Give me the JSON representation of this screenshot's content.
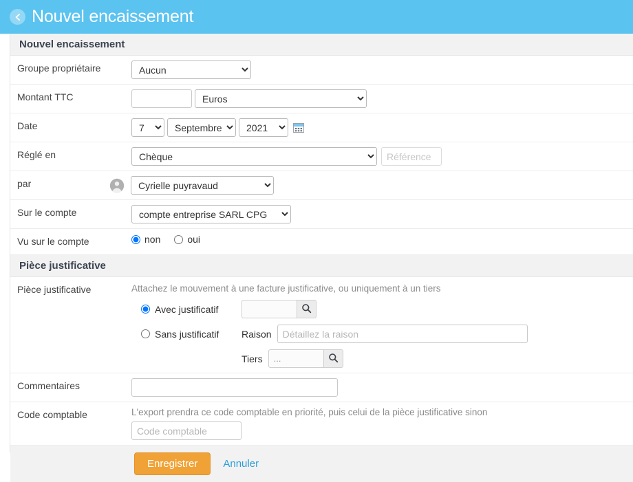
{
  "header": {
    "title": "Nouvel encaissement",
    "back_icon": "back-arrow-icon"
  },
  "form": {
    "section_title": "Nouvel encaissement",
    "rows": {
      "groupe": {
        "label": "Groupe propriétaire",
        "value": "Aucun",
        "options": [
          "Aucun"
        ]
      },
      "montant": {
        "label": "Montant TTC",
        "amount_value": "",
        "amount_placeholder": "",
        "currency_value": "Euros",
        "currency_options": [
          "Euros"
        ]
      },
      "date": {
        "label": "Date",
        "day": "7",
        "month": "Septembre",
        "year": "2021",
        "calendar_icon": "calendar-icon"
      },
      "regle_en": {
        "label": "Réglé en",
        "value": "Chèque",
        "options": [
          "Chèque"
        ],
        "reference_placeholder": "Référence",
        "reference_value": ""
      },
      "par": {
        "label": "par",
        "avatar_icon": "user-avatar-icon",
        "value": "Cyrielle puyravaud",
        "options": [
          "Cyrielle puyravaud"
        ]
      },
      "compte": {
        "label": "Sur le compte",
        "value": "compte entreprise SARL CPG",
        "options": [
          "compte entreprise SARL CPG"
        ]
      },
      "vu": {
        "label": "Vu sur le compte",
        "option_no": "non",
        "option_yes": "oui",
        "selected": "non"
      }
    }
  },
  "piece_justificative": {
    "section_title": "Pièce justificative",
    "row_label": "Pièce justificative",
    "hint": "Attachez le mouvement à une facture justificative, ou uniquement à un tiers",
    "avec_label": "Avec justificatif",
    "sans_label": "Sans justificatif",
    "selected": "avec",
    "search_icon": "search-icon",
    "avec_input_value": "",
    "raison_label": "Raison",
    "raison_placeholder": "Détaillez la raison",
    "raison_value": "",
    "tiers_label": "Tiers",
    "tiers_value": "..."
  },
  "commentaires": {
    "label": "Commentaires",
    "value": "",
    "placeholder": ""
  },
  "code_comptable": {
    "label": "Code comptable",
    "hint": "L'export prendra ce code comptable en priorité, puis celui de la pièce justificative sinon",
    "placeholder": "Code comptable",
    "value": ""
  },
  "footer": {
    "save_label": "Enregistrer",
    "cancel_label": "Annuler"
  },
  "colors": {
    "header_blue": "#5BC3F0",
    "save_orange": "#F0A236",
    "link_blue": "#2A9FD8",
    "section_gray": "#f2f2f2"
  }
}
